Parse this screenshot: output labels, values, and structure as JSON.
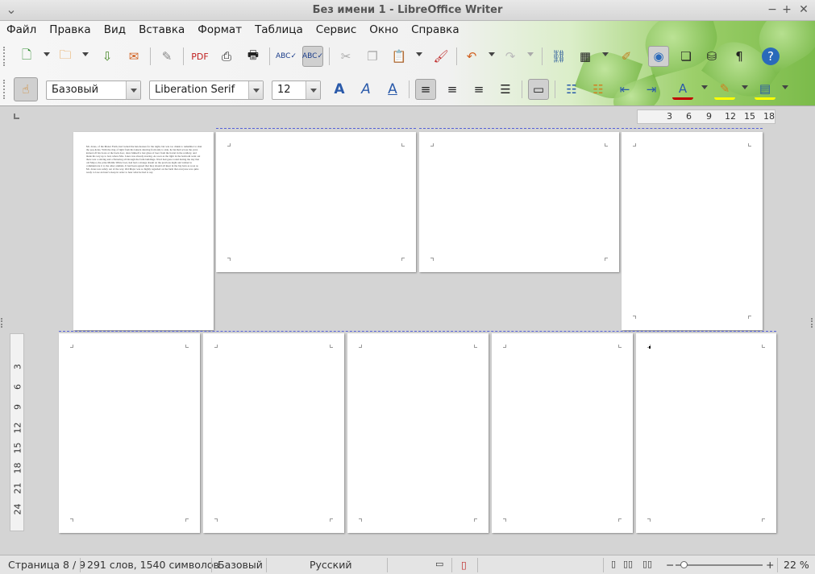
{
  "window": {
    "title": "Без имени 1 - LibreOffice Writer"
  },
  "menu": [
    "Файл",
    "Правка",
    "Вид",
    "Вставка",
    "Формат",
    "Таблица",
    "Сервис",
    "Окно",
    "Справка"
  ],
  "formatting": {
    "style": "Базовый",
    "font": "Liberation Serif",
    "size": "12"
  },
  "hruler_ticks": [
    "3",
    "6",
    "9",
    "12",
    "15",
    "18"
  ],
  "vruler_ticks": [
    "3",
    "6",
    "9",
    "12",
    "15",
    "18",
    "21",
    "24"
  ],
  "page1_text": "Mr. Jones, of the Manor Farm, had locked the hen-houses for the night, but was too drunk to remember to shut the pop-holes. With the ring of light from his lantern dancing from side to side, he lurched across the yard, kicked off his boots at the back door, drew himself a last glass of beer from the barrel in the scullery, and made his way up to bed, where Mrs. Jones was already snoring. As soon as the light in the bedroom went out there was a stirring and a fluttering all through the farm buildings. Word had gone round during the day that old Major, the prize Middle White boar, had had a strange dream on the previous night and wished to communicate it to the other animals. It had been agreed that they should all meet in the big barn as soon as Mr. Jones was safely out of the way. Old Major was so highly regarded on the farm that everyone was quite ready to lose an hour's sleep in order to hear what he had to say.",
  "status": {
    "page": "Страница 8 / 9",
    "words": "291 слов, 1540 символов",
    "style": "Базовый",
    "language": "Русский",
    "zoom": "22 %"
  },
  "colors": {
    "accent_dash": "#5560d8",
    "font_color_bar": "#c00000",
    "highlight_bar": "#ffff00"
  }
}
